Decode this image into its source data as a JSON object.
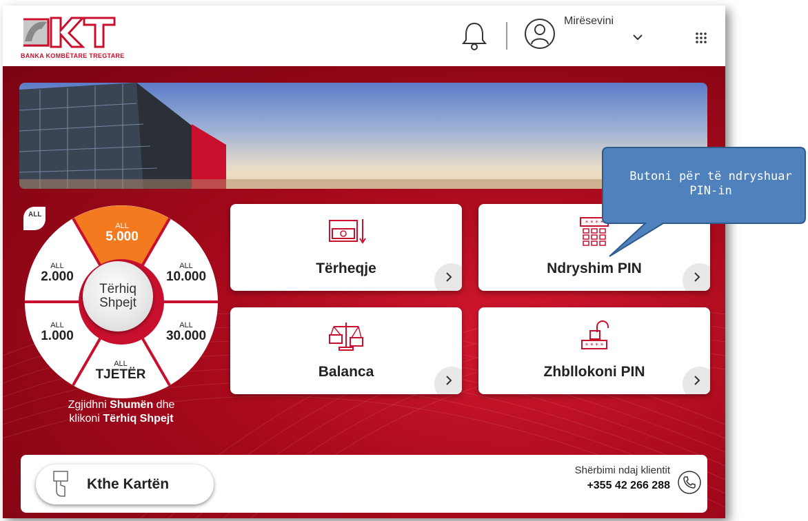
{
  "logo": {
    "mark": "BKT",
    "subtitle": "BANKA KOMBËTARE TREGTARE"
  },
  "header": {
    "welcome": "Mirësevini",
    "icons": [
      "bell-icon",
      "user-avatar-icon",
      "chevron-down-icon",
      "apps-grid-icon"
    ]
  },
  "wheel": {
    "tag": "ALL",
    "segments": [
      {
        "currency": "ALL",
        "amount": "5.000",
        "selected": true
      },
      {
        "currency": "ALL",
        "amount": "10.000"
      },
      {
        "currency": "ALL",
        "amount": "30.000"
      },
      {
        "currency": "ALL",
        "amount": "TJETËR"
      },
      {
        "currency": "ALL",
        "amount": "1.000"
      },
      {
        "currency": "ALL",
        "amount": "2.000"
      }
    ],
    "center_line1": "Tërhiq",
    "center_line2": "Shpejt",
    "selected_color": "#f47a20"
  },
  "hint": {
    "p1": "Zgjidhni ",
    "b1": "Shumën",
    "p2": " dhe",
    "p3": "klikoni ",
    "b2": "Tërhiq Shpejt"
  },
  "tiles": [
    {
      "label": "Tërheqje",
      "icon": "cash-withdraw-icon"
    },
    {
      "label": "Ndryshim PIN",
      "icon": "pin-keypad-icon"
    },
    {
      "label": "Balanca",
      "icon": "balance-scale-icon"
    },
    {
      "label": "Zhbllokoni PIN",
      "icon": "unlock-pin-icon"
    }
  ],
  "footer": {
    "return_card": "Kthe Kartën",
    "support_label": "Shërbimi ndaj klientit",
    "support_phone": "+355 42 266 288"
  },
  "callout": {
    "text": "Butoni për të ndryshuar PIN-in"
  },
  "colors": {
    "brand_red": "#c8102e",
    "callout_blue": "#4f81bd"
  }
}
